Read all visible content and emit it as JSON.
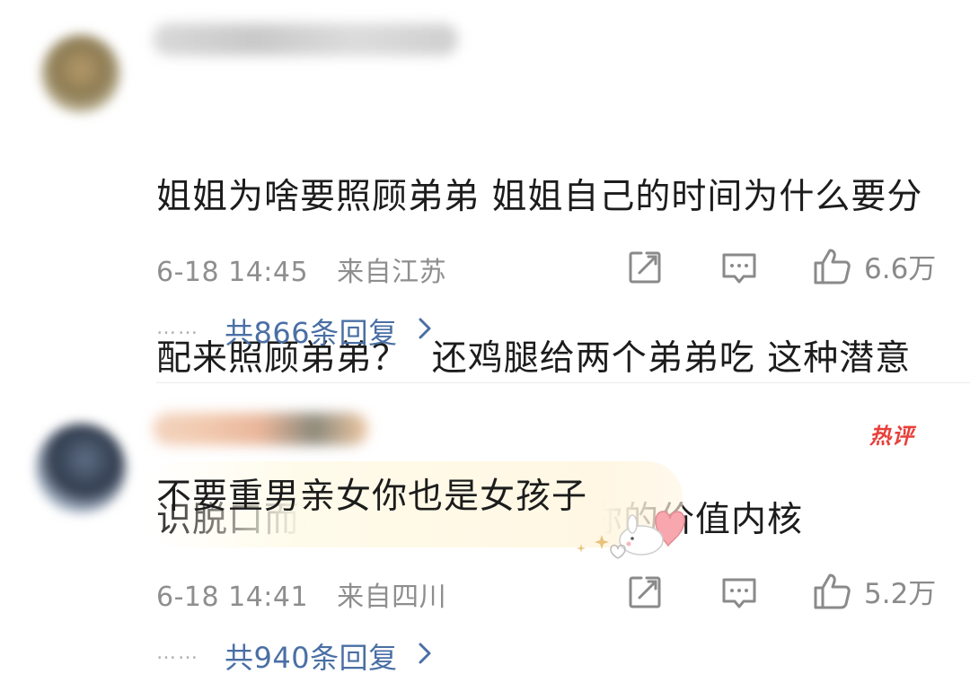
{
  "comments": [
    {
      "username": "",
      "text": "姐姐为啥要照顾弟弟 姐姐自己的时间为什么要分配来照顾弟弟？  还鸡腿给两个弟弟吃 这种潜意识脱口而出的话语足以体现你的价值内核",
      "line1": "姐姐为啥要照顾弟弟 姐姐自己的时间为什么要分",
      "line2": "配来照顾弟弟？  还鸡腿给两个弟弟吃 这种潜意",
      "line3": "识脱口而出的话语足以体现你的价值内核",
      "timestamp": "6-18 14:45",
      "location": "来自江苏",
      "likes": "6.6万",
      "replies": "共866条回复",
      "dots": "……"
    },
    {
      "username": "",
      "badge": "热评",
      "text": "不要重男亲女你也是女孩子",
      "timestamp": "6-18 14:41",
      "location": "来自四川",
      "likes": "5.2万",
      "replies": "共940条回复",
      "dots": "……"
    }
  ],
  "icons": {
    "share": "share-icon",
    "comment": "comment-icon",
    "like": "thumbs-up-icon",
    "chevron": "chevron-right-icon"
  },
  "colors": {
    "reply_link": "#4a6fa5",
    "meta": "#8e8e8e",
    "hot_badge": "#e8403a"
  }
}
